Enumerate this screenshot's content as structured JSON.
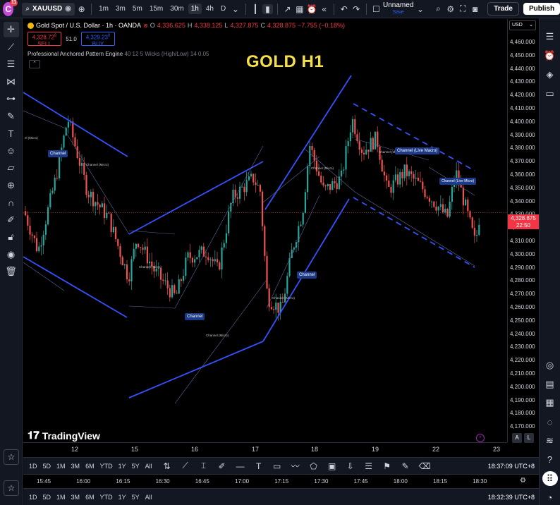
{
  "toolbar": {
    "logo": "C",
    "notif": "11",
    "symbol": "XAUUSD",
    "intervals": [
      "1m",
      "3m",
      "5m",
      "15m",
      "30m",
      "1h",
      "4h",
      "D"
    ],
    "active_interval": "1h",
    "layout_name": "Unnamed",
    "save_label": "Save",
    "trade": "Trade",
    "publish": "Publish"
  },
  "legend": {
    "title": "Gold Spot / U.S. Dollar · 1h · OANDA",
    "closed": "⊗",
    "o_lbl": "O",
    "o": "4,336.625",
    "h_lbl": "H",
    "h": "4,338.125",
    "l_lbl": "L",
    "l": "4,327.875",
    "c_lbl": "C",
    "c": "4,328.875",
    "chg": "−7.755 (−0.18%)",
    "sell_price": "4,328.72",
    "sell_sup": "0",
    "sell_label": "SELL",
    "spread": "51.0",
    "buy_price": "4,329.23",
    "buy_sup": "0",
    "buy_label": "BUY",
    "indicator_name": "Professional Anchored Pattern Engine",
    "indicator_params": "40 12 5 Wicks (High/Low) 14 0.05",
    "collapse": "⌃"
  },
  "overlay_title": "GOLD H1",
  "watermark": "TradingView",
  "chart_labels": {
    "channel": "Channel",
    "micro": "Channel (Micro)",
    "live_macro": "Channel (Live Macro)",
    "live_micro": "Channel (Live Micro)",
    "cut_micro": "el (Micro)"
  },
  "price_axis": {
    "currency": "USD",
    "ticks": [
      "4,460.000",
      "4,450.000",
      "4,440.000",
      "4,430.000",
      "4,420.000",
      "4,410.000",
      "4,400.000",
      "4,390.000",
      "4,380.000",
      "4,370.000",
      "4,360.000",
      "4,350.000",
      "4,340.000",
      "4,330.000",
      "4,320.000",
      "4,310.000",
      "4,300.000",
      "4,290.000",
      "4,280.000",
      "4,270.000",
      "4,260.000",
      "4,250.000",
      "4,240.000",
      "4,230.000",
      "4,220.000",
      "4,210.000",
      "4,200.000",
      "4,190.000",
      "4,180.000",
      "4,170.000"
    ],
    "current_price": "4,328.875",
    "countdown": "22:50"
  },
  "time_axis": {
    "labels": [
      "12",
      "15",
      "16",
      "17",
      "18",
      "19",
      "22",
      "23"
    ]
  },
  "axis_buttons": {
    "auto": "A",
    "log": "L"
  },
  "bottom1": {
    "ranges": [
      "1D",
      "5D",
      "1M",
      "3M",
      "6M",
      "YTD",
      "1Y",
      "5Y",
      "All"
    ],
    "clock": "18:37:09 UTC+8"
  },
  "time_axis2": {
    "labels": [
      "15:45",
      "16:00",
      "16:15",
      "16:30",
      "16:45",
      "17:00",
      "17:15",
      "17:30",
      "17:45",
      "18:00",
      "18:15",
      "18:30"
    ]
  },
  "bottom2": {
    "ranges": [
      "1D",
      "5D",
      "1M",
      "3M",
      "6M",
      "YTD",
      "1Y",
      "5Y",
      "All"
    ],
    "clock": "18:32:39 UTC+8"
  }
}
